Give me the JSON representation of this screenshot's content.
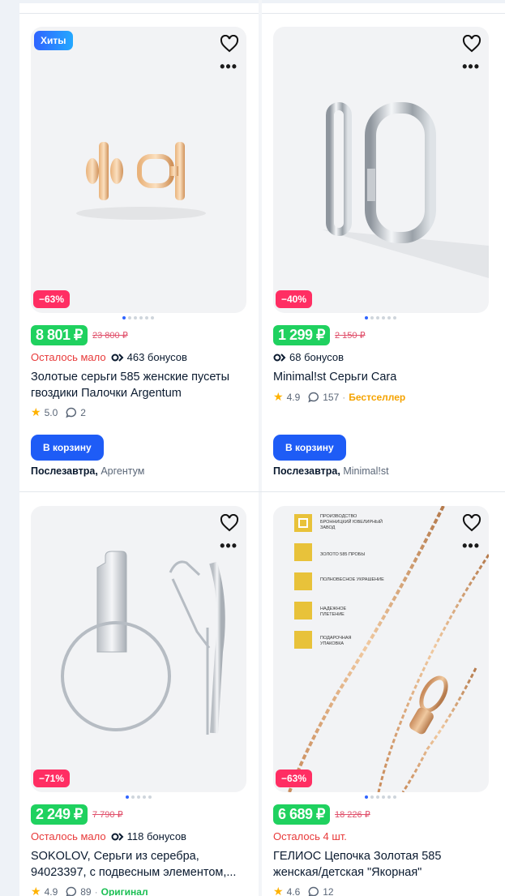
{
  "products": [
    {
      "badge": "Хиты",
      "discount": "−63%",
      "price": "8 801 ₽",
      "old_price": "23 800 ₽",
      "stock_note": "Осталось мало",
      "bonus": "463 бонусов",
      "title_line1": "Золотые серьги 585 женские пусеты",
      "title_line2": "гвоздики Палочки Argentum",
      "rating": "5.0",
      "reviews": "2",
      "tag": "",
      "cart_label": "В корзину",
      "delivery_day": "Послезавтра,",
      "seller": "Аргентум",
      "icons": [
        "heart-icon",
        "more-icon",
        "star-icon",
        "comment-icon",
        "bonus-icon"
      ]
    },
    {
      "discount": "−40%",
      "price": "1 299 ₽",
      "old_price": "2 150 ₽",
      "bonus": "68 бонусов",
      "title_line1": "Minimal!st Серьги Cara",
      "rating": "4.9",
      "reviews": "157",
      "tag": "Бестселлер",
      "cart_label": "В корзину",
      "delivery_day": "Послезавтра,",
      "seller": "Minimal!st"
    },
    {
      "discount": "−71%",
      "price": "2 249 ₽",
      "old_price": "7 790 ₽",
      "stock_note": "Осталось мало",
      "bonus": "118 бонусов",
      "title_line1": "SOKOLOV, Серьги из серебра,",
      "title_line2": "94023397, с подвесным элементом,...",
      "rating": "4.9",
      "reviews": "89",
      "tag": "Оригинал"
    },
    {
      "discount": "−63%",
      "price": "6 689 ₽",
      "old_price": "18 226 ₽",
      "stock_note": "Осталось 4 шт.",
      "title_line1": "ГЕЛИОС Цепочка Золотая 585",
      "title_line2": "женская/детская \"Якорная\"",
      "rating": "4.6",
      "reviews": "12",
      "infographic": [
        "ПРОИЗВОДСТВО БРОННИЦКИЙ ЮВЕЛИРНЫЙ ЗАВОД",
        "ЗОЛОТО 585 ПРОБЫ",
        "ПОЛНОВЕСНОЕ УКРАШЕНИЕ",
        "НАДЕЖНОЕ ПЛЕТЕНИЕ",
        "ПОДАРОЧНАЯ УПАКОВКА"
      ]
    }
  ],
  "colors": {
    "accent": "#1e5cf6",
    "price_bg": "#1fd15f",
    "discount_bg": "#ff2e63",
    "bestseller": "#f5a300"
  }
}
